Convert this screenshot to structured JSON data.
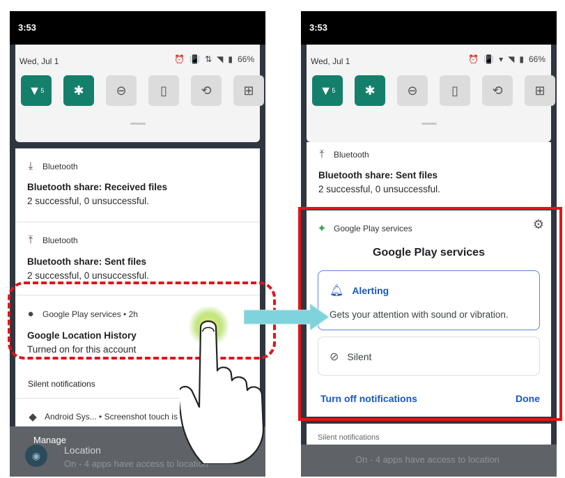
{
  "left": {
    "status_time": "3:53",
    "qs": {
      "date": "Wed, Jul 1",
      "battery": "66%",
      "wifi_badge": "5"
    },
    "notifications": [
      {
        "app": "Bluetooth",
        "title": "Bluetooth share: Received files",
        "text": "2 successful, 0 unsuccessful."
      },
      {
        "app": "Bluetooth",
        "title": "Bluetooth share: Sent files",
        "text": "2 successful, 0 unsuccessful."
      },
      {
        "app": "Google Play services • 2h",
        "title": "Google Location History",
        "text": "Turned on for this account"
      }
    ],
    "silent_label": "Silent notifications",
    "silent_item": "Android Sys... • Screenshot touch is d",
    "manage_label": "Manage",
    "behind": {
      "title": "Location",
      "text": "On - 4 apps have access to location"
    }
  },
  "right": {
    "status_time": "3:53",
    "qs": {
      "date": "Wed, Jul 1",
      "battery": "66%",
      "wifi_badge": "5"
    },
    "notification": {
      "app": "Bluetooth",
      "title": "Bluetooth share: Sent files",
      "text": "2 successful, 0 unsuccessful."
    },
    "settings_panel": {
      "app_name": "Google Play services",
      "heading": "Google Play services",
      "alerting_label": "Alerting",
      "alerting_desc": "Gets your attention with sound or vibration.",
      "silent_label": "Silent",
      "turn_off_label": "Turn off notifications",
      "done_label": "Done"
    },
    "behind": {
      "partial_text": "Silent notifications",
      "bottom_text": "On - 4 apps have access to location"
    }
  },
  "colors": {
    "accent": "#14806b",
    "highlight_red": "#e1141b",
    "link_blue": "#1a56c4",
    "arrow_cyan": "#7fd3dc"
  }
}
